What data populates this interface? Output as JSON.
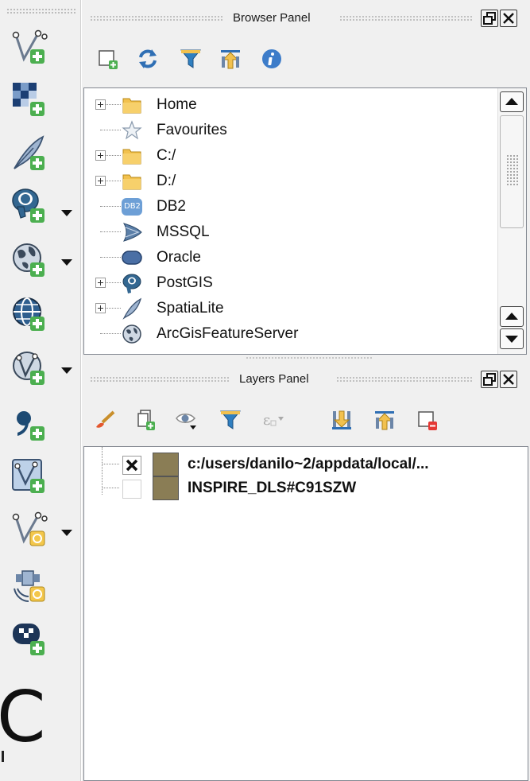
{
  "browser_panel": {
    "title": "Browser Panel",
    "toolbar": [
      {
        "name": "add-selected-layers-icon"
      },
      {
        "name": "refresh-icon"
      },
      {
        "name": "filter-icon"
      },
      {
        "name": "collapse-all-icon"
      },
      {
        "name": "info-icon"
      }
    ],
    "items": [
      {
        "label": "Home",
        "icon": "folder-icon",
        "expandable": true
      },
      {
        "label": "Favourites",
        "icon": "star-icon",
        "expandable": false
      },
      {
        "label": "C:/",
        "icon": "folder-icon",
        "expandable": true
      },
      {
        "label": "D:/",
        "icon": "folder-icon",
        "expandable": true
      },
      {
        "label": "DB2",
        "icon": "db2-icon",
        "expandable": false,
        "icon_text": "DB2"
      },
      {
        "label": "MSSQL",
        "icon": "mssql-icon",
        "expandable": false
      },
      {
        "label": "Oracle",
        "icon": "oracle-icon",
        "expandable": false
      },
      {
        "label": "PostGIS",
        "icon": "postgis-icon",
        "expandable": true
      },
      {
        "label": "SpatiaLite",
        "icon": "spatialite-icon",
        "expandable": true
      },
      {
        "label": "ArcGisFeatureServer",
        "icon": "arcgis-globe-icon",
        "expandable": false
      }
    ]
  },
  "layers_panel": {
    "title": "Layers Panel",
    "toolbar": [
      {
        "name": "style-brush-icon"
      },
      {
        "name": "add-group-icon"
      },
      {
        "name": "visibility-eye-icon"
      },
      {
        "name": "filter-legend-icon"
      },
      {
        "name": "expression-filter-icon"
      },
      {
        "name": "expand-all-icon"
      },
      {
        "name": "collapse-all-icon"
      },
      {
        "name": "remove-layer-icon"
      }
    ],
    "layers": [
      {
        "name": "c:/users/danilo~2/appdata/local/...",
        "checked": true,
        "swatch_color": "#8a7d55"
      },
      {
        "name": "INSPIRE_DLS#C91SZW",
        "checked": false,
        "swatch_color": "#8a7d55"
      }
    ]
  },
  "left_toolbar": {
    "tools": [
      {
        "name": "add-vector-layer-icon",
        "has_dropdown": false
      },
      {
        "name": "add-raster-layer-icon",
        "has_dropdown": false
      },
      {
        "name": "add-delimited-text-layer-icon",
        "has_dropdown": false
      },
      {
        "name": "add-postgis-layer-icon",
        "has_dropdown": true
      },
      {
        "name": "add-wms-layer-icon",
        "has_dropdown": true
      },
      {
        "name": "add-wcs-layer-icon",
        "has_dropdown": false
      },
      {
        "name": "add-wfs-layer-icon",
        "has_dropdown": true
      },
      {
        "name": "add-spatialite-layer-icon",
        "has_dropdown": false
      },
      {
        "name": "add-virtual-layer-icon",
        "has_dropdown": false
      },
      {
        "name": "new-shapefile-layer-icon",
        "has_dropdown": true
      },
      {
        "name": "new-gps-layer-icon",
        "has_dropdown": false
      },
      {
        "name": "add-oracle-layer-icon",
        "has_dropdown": false
      }
    ]
  },
  "colors": {
    "panel_bg": "#f0f0f0",
    "green_plus": "#4caf50",
    "folder_yellow": "#f2c14e",
    "swatch": "#8a7d55"
  }
}
